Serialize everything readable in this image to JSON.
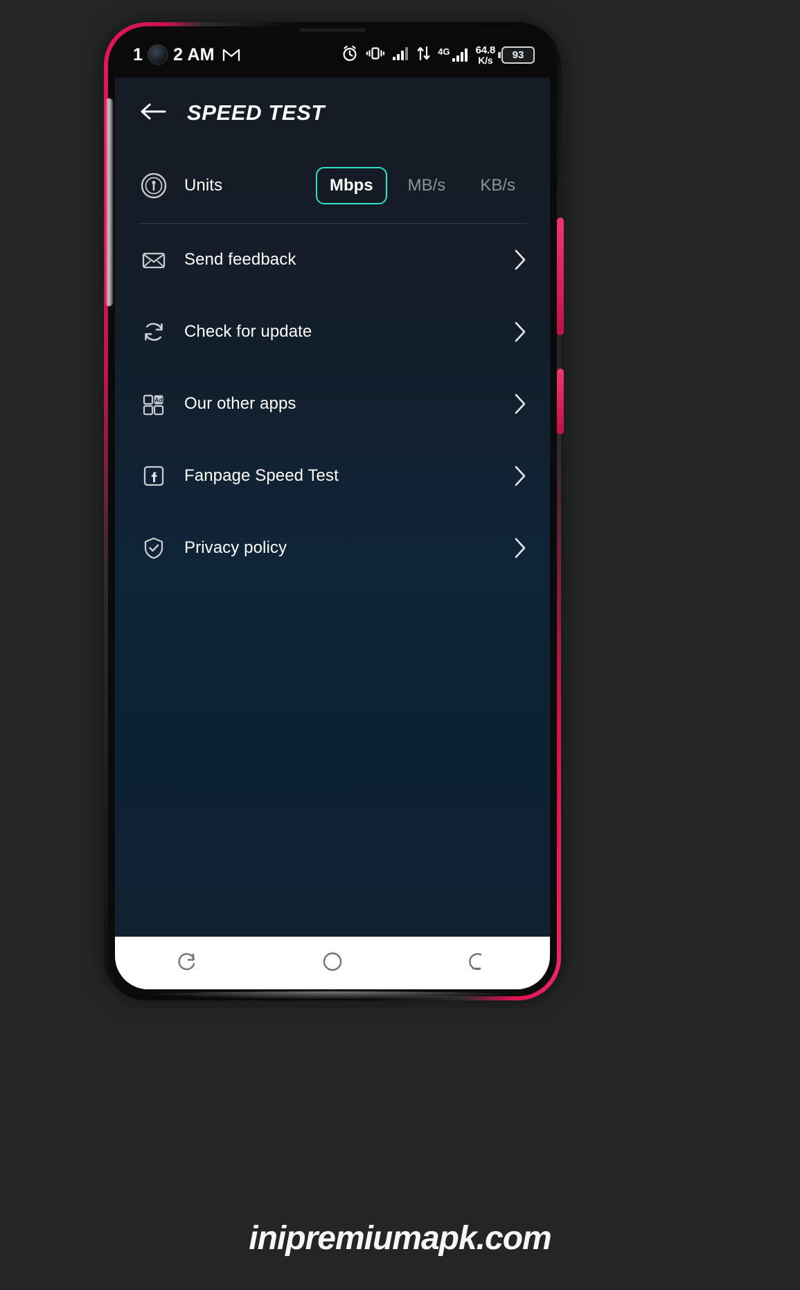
{
  "status_bar": {
    "time": "1",
    "time_suffix": "2 AM",
    "gmail_icon": "gmail-icon",
    "alarm_icon": "alarm-clock-icon",
    "vibrate_icon": "vibrate-icon",
    "signal_icon": "signal-bars-icon",
    "data_transfer_icon": "data-up-down-arrows-icon",
    "network_type": "4G",
    "network_signal_icon": "signal-bars-icon",
    "net_speed_value": "64.8",
    "net_speed_unit": "K/s",
    "battery_level": "93"
  },
  "app_bar": {
    "back_icon": "back-arrow-icon",
    "title": "SPEED TEST"
  },
  "settings": {
    "units": {
      "icon": "speedometer-icon",
      "label": "Units",
      "options": [
        {
          "label": "Mbps",
          "selected": true
        },
        {
          "label": "MB/s",
          "selected": false
        },
        {
          "label": "KB/s",
          "selected": false
        }
      ],
      "selected_value": "Mbps",
      "accent_color": "#2de0c8"
    },
    "menu_items": [
      {
        "icon": "envelope-icon",
        "label": "Send feedback",
        "chevron": "chevron-right-icon"
      },
      {
        "icon": "refresh-icon",
        "label": "Check for update",
        "chevron": "chevron-right-icon"
      },
      {
        "icon": "apps-grid-ad-icon",
        "label": "Our other apps",
        "chevron": "chevron-right-icon"
      },
      {
        "icon": "facebook-icon",
        "label": "Fanpage Speed Test",
        "chevron": "chevron-right-icon"
      },
      {
        "icon": "shield-check-icon",
        "label": "Privacy policy",
        "chevron": "chevron-right-icon"
      }
    ]
  },
  "nav_bar": {
    "recents_icon": "recents-icon",
    "home_icon": "home-circle-icon",
    "back_icon": "back-nav-icon"
  },
  "watermark": {
    "text": "inipremiumapk.com"
  }
}
